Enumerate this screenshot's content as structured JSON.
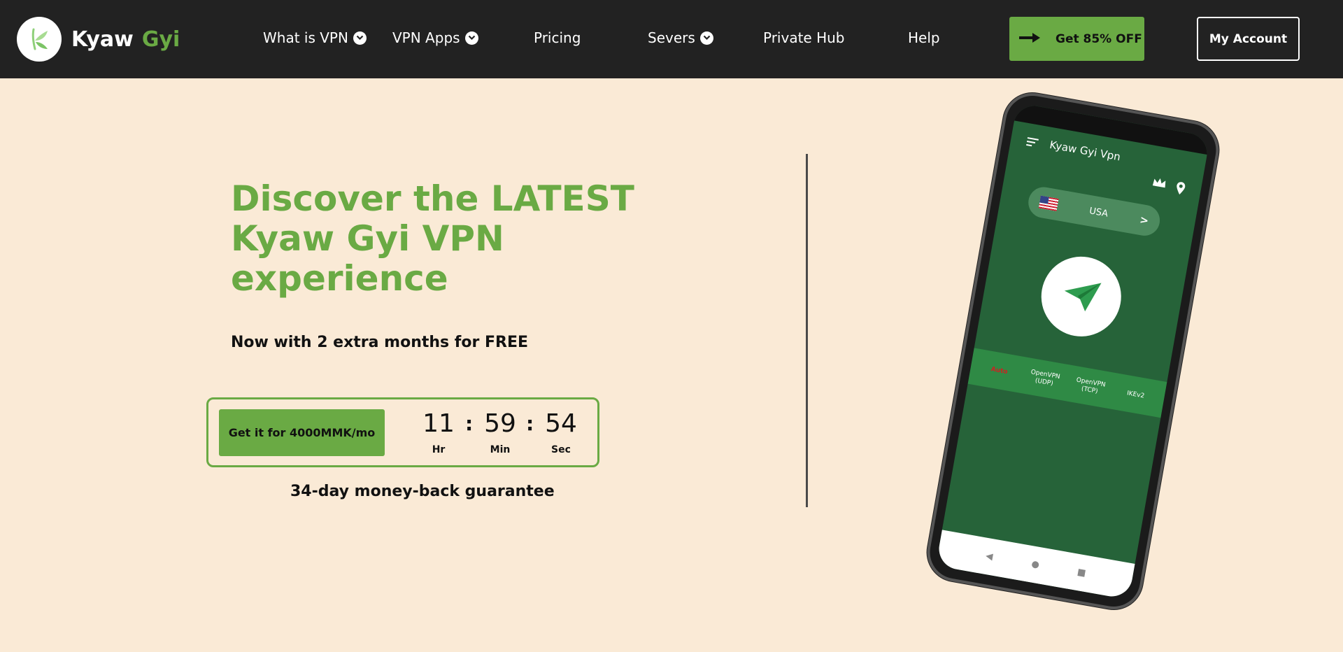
{
  "header": {
    "brand": {
      "first": "Kyaw",
      "second": "Gyi"
    },
    "nav": [
      {
        "label": "What is VPN",
        "has_dropdown": true
      },
      {
        "label": "VPN Apps",
        "has_dropdown": true
      },
      {
        "label": "Pricing",
        "has_dropdown": false
      },
      {
        "label": "Severs",
        "has_dropdown": true
      },
      {
        "label": "Private Hub",
        "has_dropdown": false
      },
      {
        "label": "Help",
        "has_dropdown": false
      }
    ],
    "offer_button": "Get 85% OFF",
    "account_button": "My Account"
  },
  "hero": {
    "title_lines": [
      "Discover the LATEST",
      "Kyaw Gyi VPN",
      "experience"
    ],
    "subtitle": "Now with 2 extra months for FREE",
    "buy_button": "Get it for 4000MMK/mo",
    "timer": {
      "hours": "11",
      "minutes": "59",
      "seconds": "54",
      "hours_label": "Hr",
      "minutes_label": "Min",
      "seconds_label": "Sec",
      "separator": ":"
    },
    "guarantee": "34-day money-back guarantee"
  },
  "phone": {
    "app_title": "Kyaw Gyi Vpn",
    "country": "USA",
    "country_arrow": ">",
    "protocols": [
      {
        "label": "Auto",
        "active": true
      },
      {
        "label": "OpenVPN (UDP)",
        "active": false
      },
      {
        "label": "OpenVPN (TCP)",
        "active": false
      },
      {
        "label": "IKEv2",
        "active": false
      }
    ]
  },
  "colors": {
    "header_bg": "#222222",
    "page_bg": "#faead6",
    "accent_green": "#6aaa44",
    "app_green": "#266339"
  },
  "icons": [
    "logo-leaf-icon",
    "chevron-down-icon",
    "arrow-right-icon",
    "menu-icon",
    "crown-icon",
    "location-pin-icon",
    "flag-usa-icon",
    "paper-plane-icon",
    "back-icon",
    "home-icon",
    "recents-icon"
  ]
}
